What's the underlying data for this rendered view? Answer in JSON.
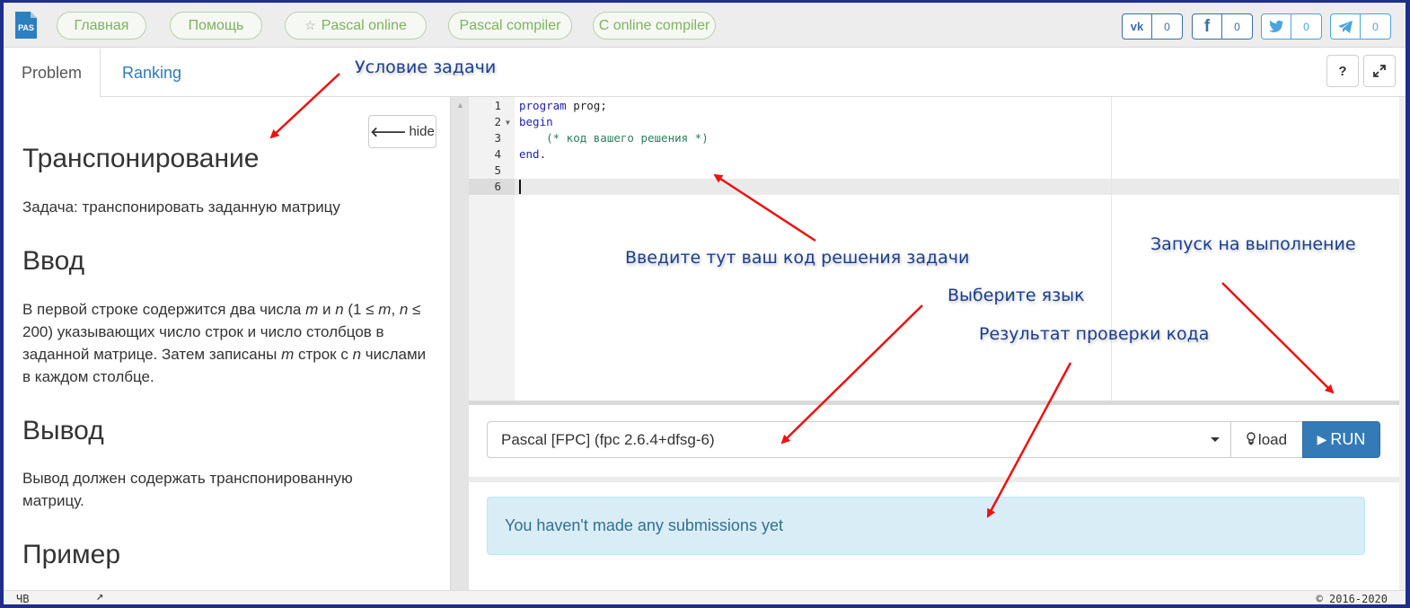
{
  "logo": {
    "text": "PAS"
  },
  "nav": {
    "home": "Главная",
    "help": "Помощь",
    "pascal_online": "Pascal online",
    "pascal_compiler": "Pascal compiler",
    "c_compiler": "C online compiler"
  },
  "share": [
    {
      "icon": "vk-icon",
      "glyph": "vk",
      "count": "0"
    },
    {
      "icon": "facebook-icon",
      "glyph": "f",
      "count": "0"
    },
    {
      "icon": "twitter-icon",
      "glyph": "t",
      "count": "0"
    },
    {
      "icon": "telegram-icon",
      "glyph": "tg",
      "count": "0"
    }
  ],
  "tabs": {
    "problem": "Problem",
    "ranking": "Ranking"
  },
  "toolbar": {
    "help_label": "?",
    "fullscreen_icon": "expand-icon"
  },
  "problem": {
    "hide_label": "hide",
    "title": "Транспонирование",
    "statement": "Задача: транспонировать заданную матрицу",
    "input_heading": "Ввод",
    "input_text": {
      "p1": "В первой строке содержится два числа ",
      "m1": "m",
      "p2": " и ",
      "n1": "n",
      "p3": " (1 ≤ ",
      "m2": "m",
      "p4": ", ",
      "n2": "n",
      "p5": " ≤ 200) указывающих число строк и число столбцов в заданной матрице. Затем записаны ",
      "m3": "m",
      "p6": " строк с ",
      "n3": "n",
      "p7": " числами в каждом столбце."
    },
    "output_heading": "Вывод",
    "output_text": "Вывод должен содержать транспонированную матрицу.",
    "example_heading": "Пример"
  },
  "editor": {
    "line_numbers": [
      "1",
      "2",
      "3",
      "4",
      "5",
      "6"
    ],
    "lines": [
      {
        "kw": "program",
        "rest": " prog;"
      },
      {
        "kw": "begin",
        "rest": ""
      },
      {
        "comment": "    (* код вашего решения *)"
      },
      {
        "kw": "end",
        "rest": "."
      },
      {
        "rest": ""
      },
      {
        "rest": ""
      }
    ]
  },
  "language": {
    "selected": "Pascal [FPC] (fpc 2.6.4+dfsg-6)"
  },
  "actions": {
    "load_label": "load",
    "run_label": "RUN"
  },
  "submissions": {
    "empty_message": "You haven't made any submissions yet"
  },
  "statusbar": {
    "left": "ЧВ",
    "right": "© 2016-2020"
  },
  "annotations": {
    "problem": "Условие задачи",
    "code": "Введите тут ваш код решения задачи",
    "run": "Запуск на выполнение",
    "language": "Выберите язык",
    "result": "Результат проверки кода"
  },
  "colors": {
    "arrow": "#ee1111",
    "annotation_text": "#1a3f8f",
    "nav_green": "#7cb35d",
    "run_button": "#337ab7",
    "alert_bg": "#d9edf7"
  }
}
